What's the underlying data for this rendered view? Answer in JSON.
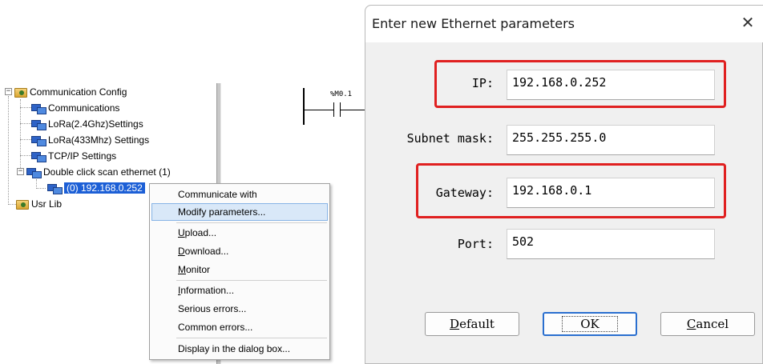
{
  "tree": {
    "items": [
      {
        "label": "Communication Config",
        "icon": "folder-gear-icon"
      },
      {
        "label": "Communications",
        "icon": "network-icon"
      },
      {
        "label": "LoRa(2.4Ghz)Settings",
        "icon": "network-icon"
      },
      {
        "label": "LoRa(433Mhz) Settings",
        "icon": "network-icon"
      },
      {
        "label": "TCP/IP Settings",
        "icon": "network-icon"
      },
      {
        "label": "Double click scan ethernet (1)",
        "icon": "network-icon"
      },
      {
        "label": "(0) 192.168.0.252",
        "icon": "network-icon",
        "selected": true
      },
      {
        "label": "Usr Lib",
        "icon": "folder-gear-icon"
      }
    ]
  },
  "ladder": {
    "variable": "%M0.1"
  },
  "context_menu": {
    "items": [
      {
        "label": "Communicate with"
      },
      {
        "label": "Modify parameters...",
        "highlighted": true
      },
      {
        "label": "Upload...",
        "mnemonic": "U"
      },
      {
        "label": "Download...",
        "mnemonic": "D"
      },
      {
        "label": "Monitor",
        "mnemonic": "M"
      },
      {
        "label": "Information...",
        "mnemonic": "I"
      },
      {
        "label": "Serious errors..."
      },
      {
        "label": "Common errors..."
      },
      {
        "label": "Display in the dialog box..."
      }
    ]
  },
  "dialog": {
    "title": "Enter new Ethernet parameters",
    "close_glyph": "✕",
    "fields": {
      "ip": {
        "label": "IP:",
        "value": "192.168.0.252"
      },
      "subnet": {
        "label": "Subnet mask:",
        "value": "255.255.255.0"
      },
      "gateway": {
        "label": "Gateway:",
        "value": "192.168.0.1"
      },
      "port": {
        "label": "Port:",
        "value": "502"
      }
    },
    "buttons": {
      "default": "Default",
      "ok": "OK",
      "cancel": "Cancel"
    },
    "highlight_color": "#e02020"
  }
}
